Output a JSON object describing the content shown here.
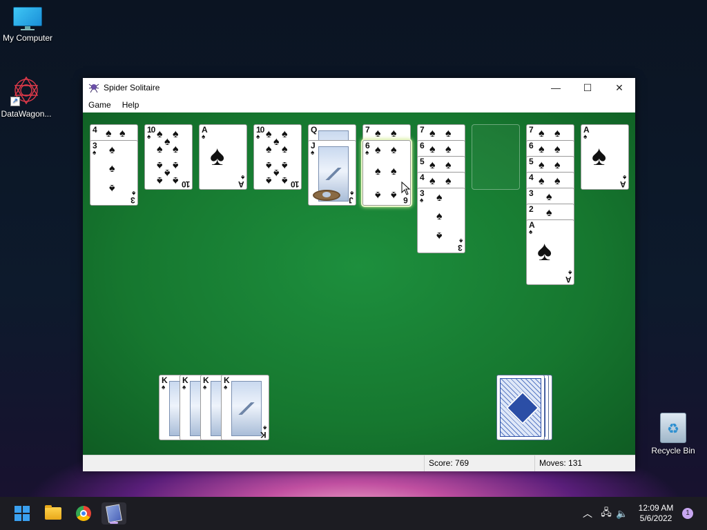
{
  "desktop": {
    "icons": [
      {
        "label": "My Computer",
        "icon": "monitor-icon"
      },
      {
        "label": "DataWagon...",
        "icon": "datawagon-logo-icon"
      },
      {
        "label": "Recycle Bin",
        "icon": "recycle-bin-icon"
      }
    ]
  },
  "window": {
    "title": "Spider Solitaire",
    "menu": [
      "Game",
      "Help"
    ],
    "controls": {
      "minimize": "—",
      "maximize": "☐",
      "close": "✕"
    }
  },
  "game": {
    "suit": "♠",
    "tableau": [
      {
        "cards": [
          "4",
          "3"
        ]
      },
      {
        "cards": [
          "10"
        ]
      },
      {
        "cards": [
          "A"
        ]
      },
      {
        "cards": [
          "10"
        ]
      },
      {
        "cards": [
          "Q",
          "J"
        ]
      },
      {
        "cards": [
          "7",
          "6"
        ]
      },
      {
        "cards": [
          "7",
          "6",
          "5",
          "4",
          "3"
        ]
      },
      {
        "cards": []
      },
      {
        "cards": [
          "7",
          "6",
          "5",
          "4",
          "3",
          "2",
          "A"
        ]
      },
      {
        "cards": [
          "A"
        ]
      }
    ],
    "completed_foundations": [
      "K",
      "K",
      "K",
      "K",
      "K"
    ],
    "stock_piles": 3
  },
  "status": {
    "score_label": "Score:",
    "score": "769",
    "moves_label": "Moves:",
    "moves": "131"
  },
  "taskbar": {
    "apps": [
      "start",
      "file-explorer",
      "chrome",
      "spider-solitaire"
    ],
    "time": "12:09 AM",
    "date": "5/6/2022",
    "notifications": "1"
  }
}
